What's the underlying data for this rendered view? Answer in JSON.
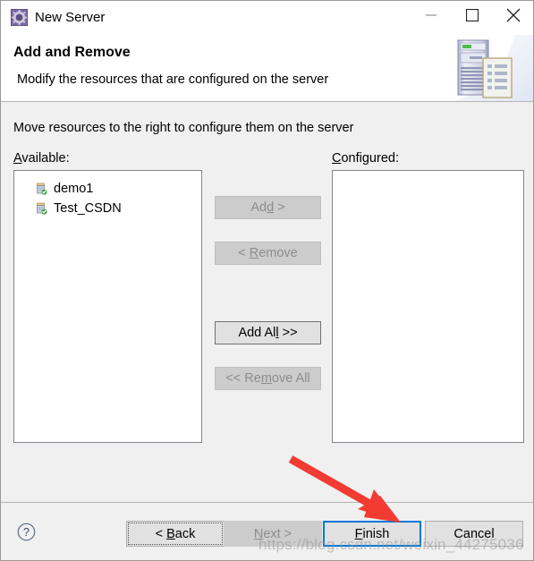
{
  "window": {
    "title": "New Server",
    "icon": "server-wizard-icon",
    "controls": {
      "minimize": "minimize-icon",
      "maximize": "maximize-icon",
      "close": "close-icon"
    }
  },
  "header": {
    "title": "Add and Remove",
    "description": "Modify the resources that are configured on the server",
    "art": "server-and-document-icon"
  },
  "content": {
    "instruction": "Move resources to the right to configure them on the server",
    "available": {
      "label_pre": "A",
      "label_post": "vailable:",
      "items": [
        {
          "name": "demo1",
          "icon": "module-icon"
        },
        {
          "name": "Test_CSDN",
          "icon": "module-icon"
        }
      ]
    },
    "configured": {
      "label_pre": "C",
      "label_post": "onfigured:",
      "items": []
    },
    "transfer_buttons": [
      {
        "pre": "Ad",
        "mn": "d",
        "post": " >",
        "enabled": false,
        "name": "add-button"
      },
      {
        "pre": "< ",
        "mn": "R",
        "post": "emove",
        "enabled": false,
        "name": "remove-button"
      },
      {
        "pre": "Add Al",
        "mn": "l",
        "post": " >>",
        "enabled": true,
        "name": "add-all-button"
      },
      {
        "pre": "<< Re",
        "mn": "m",
        "post": "ove All",
        "enabled": false,
        "name": "remove-all-button"
      }
    ]
  },
  "footer": {
    "help": "help-icon",
    "back": {
      "pre": "< ",
      "mn": "B",
      "post": "ack"
    },
    "next": {
      "pre": "",
      "mn": "N",
      "post": "ext >"
    },
    "finish": {
      "pre": "",
      "mn": "F",
      "post": "inish"
    },
    "cancel": {
      "pre": "",
      "mn": "",
      "post": "Cancel"
    }
  },
  "annotation": {
    "arrow_color": "#f23b32",
    "watermark": "https://blog.csdn.net/weixin_44275036"
  },
  "colors": {
    "accent": "#0078d7",
    "dialog_bg": "#f0f0f0",
    "banner_bg": "#ffffff",
    "disabled_text": "#8d8d8d"
  }
}
